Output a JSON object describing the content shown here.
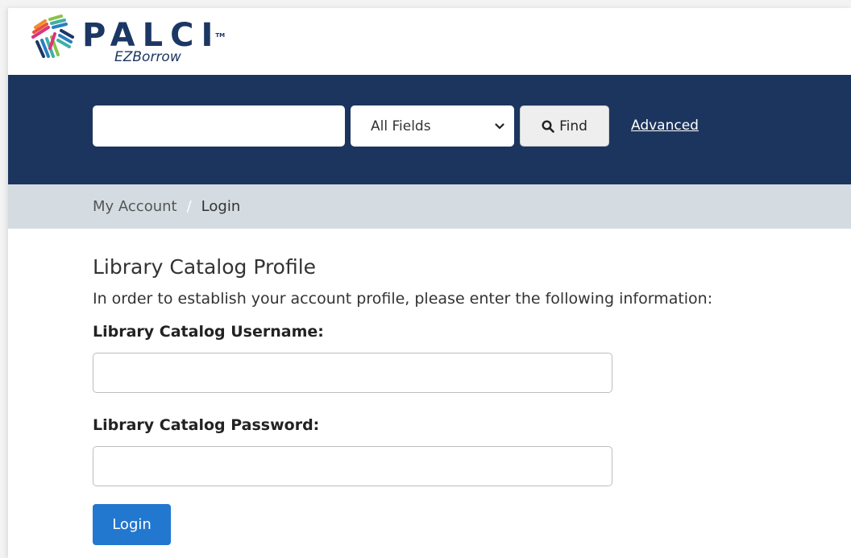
{
  "brand": {
    "name": "PALCI",
    "trademark": "TM",
    "subtitle": "EZBorrow",
    "color": "#1c3764"
  },
  "search": {
    "input_value": "",
    "input_placeholder": "",
    "field_selected": "All Fields",
    "find_label": "Find",
    "advanced_label": "Advanced",
    "bar_color": "#1c355e"
  },
  "breadcrumb": {
    "items": [
      "My Account",
      "Login"
    ],
    "separator": "/"
  },
  "main": {
    "heading": "Library Catalog Profile",
    "intro": "In order to establish your account profile, please enter the following information:",
    "username_label": "Library Catalog Username:",
    "username_value": "",
    "password_label": "Library Catalog Password:",
    "password_value": "",
    "login_label": "Login",
    "login_color": "#2277cf"
  }
}
